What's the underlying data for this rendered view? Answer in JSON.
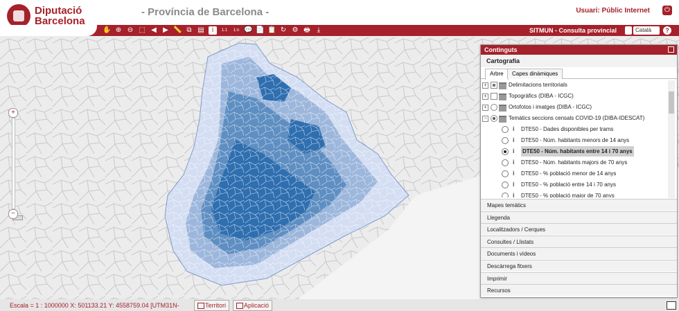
{
  "header": {
    "brand_line1": "Diputació",
    "brand_line2": "Barcelona",
    "title": "- Província de Barcelona -",
    "user": "Usuari: Públic Internet"
  },
  "toolbar": {
    "app_name": "SITMUN - Consulta provincial",
    "language": "Català",
    "tools": [
      "pan-hand-icon",
      "zoom-in-icon",
      "zoom-out-icon",
      "zoom-box-icon",
      "zoom-prev-icon",
      "zoom-next-icon",
      "measure-ruler-icon",
      "copy-icon",
      "layers-icon",
      "info-icon",
      "scale-1-1-icon",
      "scale-n-icon",
      "comment-icon",
      "report-icon",
      "export-icon",
      "refresh-icon",
      "settings-icon",
      "print-icon",
      "download-icon"
    ],
    "tool_glyphs": [
      "✋",
      "⊕",
      "⊖",
      "⬚",
      "◀",
      "▶",
      "📏",
      "⧉",
      "▤",
      "i",
      "1:1",
      "1:n",
      "💬",
      "📄",
      "📋",
      "↻",
      "⚙",
      "🖶",
      "⤓"
    ]
  },
  "colors": {
    "brand": "#a5212b",
    "map_dark": "#2f6fb0",
    "map_mid": "#6f9cc8",
    "map_light": "#c9d7ef",
    "map_lightest": "#e5ebf8",
    "map_base": "#e9e9e9"
  },
  "panel": {
    "title": "Continguts",
    "section": "Cartografia",
    "tabs": [
      "Arbre",
      "Capes dinàmiques"
    ],
    "groups": [
      {
        "label": "Delimitacions territorials",
        "expander": "+",
        "control": "checkbox-partial"
      },
      {
        "label": "Topogràfics (DIBA - ICGC)",
        "expander": "+",
        "control": "checkbox"
      },
      {
        "label": "Ortofotos i imatges (DIBA - ICGC)",
        "expander": "+",
        "control": "radio"
      },
      {
        "label": "Temàtics seccions censals COVID-19 (DIBA-IDESCAT)",
        "expander": "−",
        "control": "radio-selected"
      }
    ],
    "layers": [
      {
        "label": "DTE50 - Dades disponibles per trams",
        "selected": false
      },
      {
        "label": "DTE50 - Núm. habitants menors de 14 anys",
        "selected": false
      },
      {
        "label": "DTE50 - Núm. habitants entre 14 i 70 anys",
        "selected": true
      },
      {
        "label": "DTE50 - Núm. habitants majors de 70 anys",
        "selected": false
      },
      {
        "label": "DTE50 - % població menor de 14 anys",
        "selected": false
      },
      {
        "label": "DTE50 - % població entre 14 i 70 anys",
        "selected": false
      },
      {
        "label": "DTE50 - % població major de 70 anys",
        "selected": false
      }
    ],
    "accordion": [
      "Mapes temàtics",
      "Llegenda",
      "Localitzadors / Cerques",
      "Consultes / Llistats",
      "Documents i vídeos",
      "Descàrrega fitxers",
      "Imprimir",
      "Recursos"
    ]
  },
  "status": {
    "scale": "Escala = 1 : 1000000  X: 501133.21 Y: 4558759.04 [UTM31N-",
    "territori": "Territori",
    "aplicacio": "Aplicació"
  },
  "zoom": {
    "plus": "+",
    "minus": "−"
  }
}
